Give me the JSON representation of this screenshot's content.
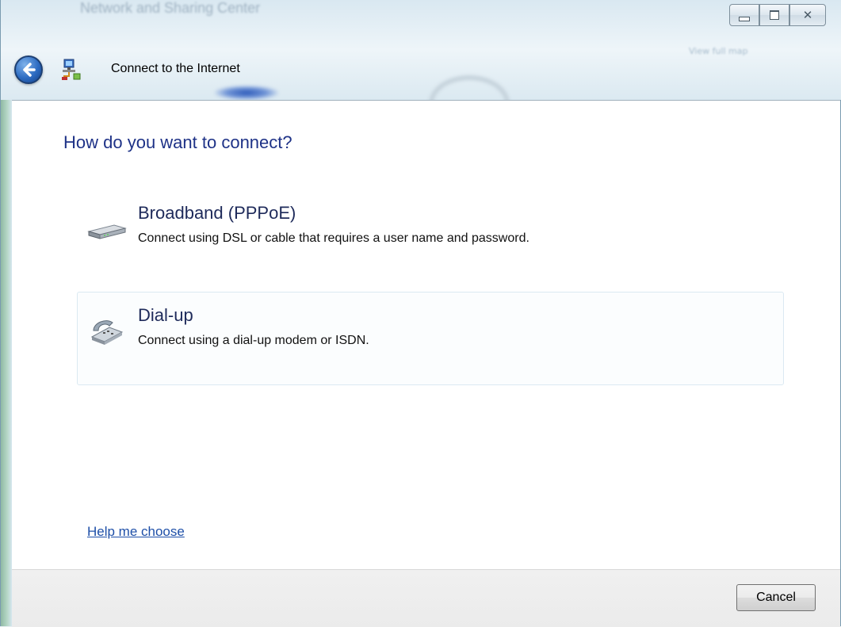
{
  "window": {
    "background_title": "Network and Sharing Center",
    "background_link": "View full map",
    "title": "Connect to the Internet",
    "controls": {
      "minimize": "minimize",
      "maximize": "maximize",
      "close": "close"
    }
  },
  "main": {
    "heading": "How do you want to connect?",
    "options": [
      {
        "title": "Broadband (PPPoE)",
        "description": "Connect using DSL or cable that requires a user name and password.",
        "icon": "broadband-modem-icon"
      },
      {
        "title": "Dial-up",
        "description": "Connect using a dial-up modem or ISDN.",
        "icon": "dialup-phone-icon"
      }
    ],
    "help_link": "Help me choose"
  },
  "footer": {
    "cancel_label": "Cancel"
  },
  "colors": {
    "heading": "#1e3287",
    "link": "#1e4fa8",
    "hover_border": "#dbe9f2"
  }
}
